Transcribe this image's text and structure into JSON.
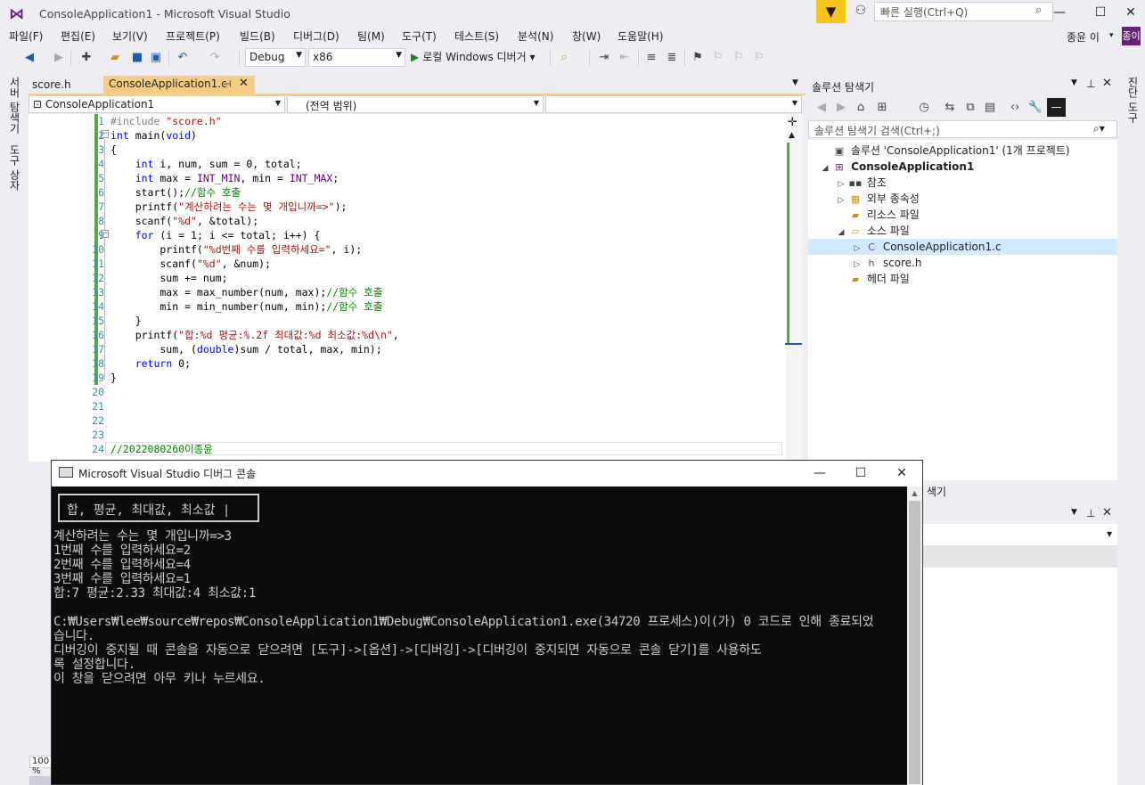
{
  "window": {
    "title": "ConsoleApplication1 - Microsoft Visual Studio",
    "quick_launch_placeholder": "빠른 실행(Ctrl+Q)",
    "user_name": "종윤 이",
    "user_badge": "종이"
  },
  "menu": [
    "파일(F)",
    "편집(E)",
    "보기(V)",
    "프로젝트(P)",
    "빌드(B)",
    "디버그(D)",
    "팀(M)",
    "도구(T)",
    "테스트(S)",
    "분석(N)",
    "창(W)",
    "도움말(H)"
  ],
  "toolbar": {
    "config": "Debug",
    "platform": "x86",
    "run_label": "로컬 Windows 디버거"
  },
  "side_tabs": {
    "server_explorer": "서버 탐색기",
    "toolbox": "도구 상자",
    "diagnostics": "진단 도구"
  },
  "editor": {
    "tabs": [
      {
        "label": "score.h"
      },
      {
        "label": "ConsoleApplication1.c"
      }
    ],
    "nav_project": "ConsoleApplication1",
    "nav_scope": "(전역 범위)",
    "zoom": "100 %",
    "lines": [
      {
        "n": "1",
        "segments": [
          {
            "t": "#include ",
            "c": "pp"
          },
          {
            "t": "\"score.h\"",
            "c": "str"
          }
        ]
      },
      {
        "n": "2",
        "segments": [
          {
            "t": "int",
            "c": "kw"
          },
          {
            "t": " main(",
            "c": "plain"
          },
          {
            "t": "void",
            "c": "kw"
          },
          {
            "t": ")",
            "c": "plain"
          }
        ]
      },
      {
        "n": "3",
        "segments": [
          {
            "t": "{",
            "c": "plain"
          }
        ]
      },
      {
        "n": "4",
        "segments": [
          {
            "t": "    ",
            "c": "plain"
          },
          {
            "t": "int",
            "c": "kw"
          },
          {
            "t": " i, num, sum = 0, total;",
            "c": "plain"
          }
        ]
      },
      {
        "n": "5",
        "segments": [
          {
            "t": "    ",
            "c": "plain"
          },
          {
            "t": "int",
            "c": "kw"
          },
          {
            "t": " max = ",
            "c": "plain"
          },
          {
            "t": "INT_MIN",
            "c": "mac"
          },
          {
            "t": ", min = ",
            "c": "plain"
          },
          {
            "t": "INT_MAX",
            "c": "mac"
          },
          {
            "t": ";",
            "c": "plain"
          }
        ]
      },
      {
        "n": "6",
        "segments": [
          {
            "t": "    start();",
            "c": "plain"
          },
          {
            "t": "//함수 호출",
            "c": "cmt"
          }
        ]
      },
      {
        "n": "7",
        "segments": [
          {
            "t": "    printf(",
            "c": "plain"
          },
          {
            "t": "\"계산하려는 수는 몇 개입니까=>\"",
            "c": "str"
          },
          {
            "t": ");",
            "c": "plain"
          }
        ]
      },
      {
        "n": "8",
        "segments": [
          {
            "t": "    scanf(",
            "c": "plain"
          },
          {
            "t": "\"%d\"",
            "c": "str"
          },
          {
            "t": ", &total);",
            "c": "plain"
          }
        ]
      },
      {
        "n": "9",
        "segments": [
          {
            "t": "    ",
            "c": "plain"
          },
          {
            "t": "for",
            "c": "kw"
          },
          {
            "t": " (i = 1; i <= total; i++) {",
            "c": "plain"
          }
        ]
      },
      {
        "n": "10",
        "segments": [
          {
            "t": "        printf(",
            "c": "plain"
          },
          {
            "t": "\"%d번째 수를 입력하세요=\"",
            "c": "str"
          },
          {
            "t": ", i);",
            "c": "plain"
          }
        ]
      },
      {
        "n": "11",
        "segments": [
          {
            "t": "        scanf(",
            "c": "plain"
          },
          {
            "t": "\"%d\"",
            "c": "str"
          },
          {
            "t": ", &num);",
            "c": "plain"
          }
        ]
      },
      {
        "n": "12",
        "segments": [
          {
            "t": "        sum += num;",
            "c": "plain"
          }
        ]
      },
      {
        "n": "13",
        "segments": [
          {
            "t": "        max = max_number(num, max);",
            "c": "plain"
          },
          {
            "t": "//함수 호출",
            "c": "cmt"
          }
        ]
      },
      {
        "n": "14",
        "segments": [
          {
            "t": "        min = min_number(num, min);",
            "c": "plain"
          },
          {
            "t": "//함수 호출",
            "c": "cmt"
          }
        ]
      },
      {
        "n": "15",
        "segments": [
          {
            "t": "    }",
            "c": "plain"
          }
        ]
      },
      {
        "n": "16",
        "segments": [
          {
            "t": "    printf(",
            "c": "plain"
          },
          {
            "t": "\"합:%d 평균:%.2f 최대값:%d 최소값:%d\\n\"",
            "c": "str"
          },
          {
            "t": ",",
            "c": "plain"
          }
        ]
      },
      {
        "n": "17",
        "segments": [
          {
            "t": "        sum, (",
            "c": "plain"
          },
          {
            "t": "double",
            "c": "kw"
          },
          {
            "t": ")sum / total, max, min);",
            "c": "plain"
          }
        ]
      },
      {
        "n": "18",
        "segments": [
          {
            "t": "    ",
            "c": "plain"
          },
          {
            "t": "return",
            "c": "kw"
          },
          {
            "t": " 0;",
            "c": "plain"
          }
        ]
      },
      {
        "n": "19",
        "segments": [
          {
            "t": "}",
            "c": "plain"
          }
        ]
      },
      {
        "n": "20",
        "segments": []
      },
      {
        "n": "21",
        "segments": []
      },
      {
        "n": "22",
        "segments": []
      },
      {
        "n": "23",
        "segments": []
      },
      {
        "n": "24",
        "segments": [
          {
            "t": "//2022080260이종윤",
            "c": "cmt"
          }
        ]
      }
    ]
  },
  "solution_explorer": {
    "title": "솔루션 탐색기",
    "search_placeholder": "솔루션 탐색기 검색(Ctrl+;)",
    "items": [
      {
        "label": "솔루션 'ConsoleApplication1' (1개 프로젝트)",
        "icon": "solution-icon",
        "twisty": "",
        "bold": false
      },
      {
        "label": "ConsoleApplication1",
        "icon": "project-icon",
        "twisty": "expanded",
        "bold": true
      },
      {
        "label": "참조",
        "icon": "references-icon",
        "twisty": "collapsed",
        "bold": false
      },
      {
        "label": "외부 종속성",
        "icon": "external-deps-icon",
        "twisty": "collapsed",
        "bold": false
      },
      {
        "label": "리소스 파일",
        "icon": "folder-icon",
        "twisty": "",
        "bold": false
      },
      {
        "label": "소스 파일",
        "icon": "folder-open-icon",
        "twisty": "expanded",
        "bold": false
      },
      {
        "label": "ConsoleApplication1.c",
        "icon": "c-file-icon",
        "twisty": "collapsed",
        "bold": false
      },
      {
        "label": "score.h",
        "icon": "h-file-icon",
        "twisty": "collapsed",
        "bold": false
      },
      {
        "label": "헤더 파일",
        "icon": "folder-icon",
        "twisty": "",
        "bold": false
      }
    ],
    "bottom_tab_fragment": "색기"
  },
  "console": {
    "title": "Microsoft Visual Studio 디버그 콘솔",
    "banner": "합, 평균, 최대값, 최소값 |",
    "lines": [
      "계산하려는 수는 몇 개입니까=>3",
      "1번째 수를 입력하세요=2",
      "2번째 수를 입력하세요=4",
      "3번째 수를 입력하세요=1",
      "합:7 평균:2.33 최대값:4 최소값:1",
      "",
      "C:₩Users₩lee₩source₩repos₩ConsoleApplication1₩Debug₩ConsoleApplication1.exe(34720 프로세스)이(가) 0 코드로 인해 종료되었",
      "습니다.",
      "디버깅이 중지될 때 콘솔을 자동으로 닫으려면 [도구]->[옵션]->[디버깅]->[디버깅이 중지되면 자동으로 콘솔 닫기]를 사용하도",
      "록 설정합니다.",
      "이 창을 닫으려면 아무 키나 누르세요."
    ]
  }
}
